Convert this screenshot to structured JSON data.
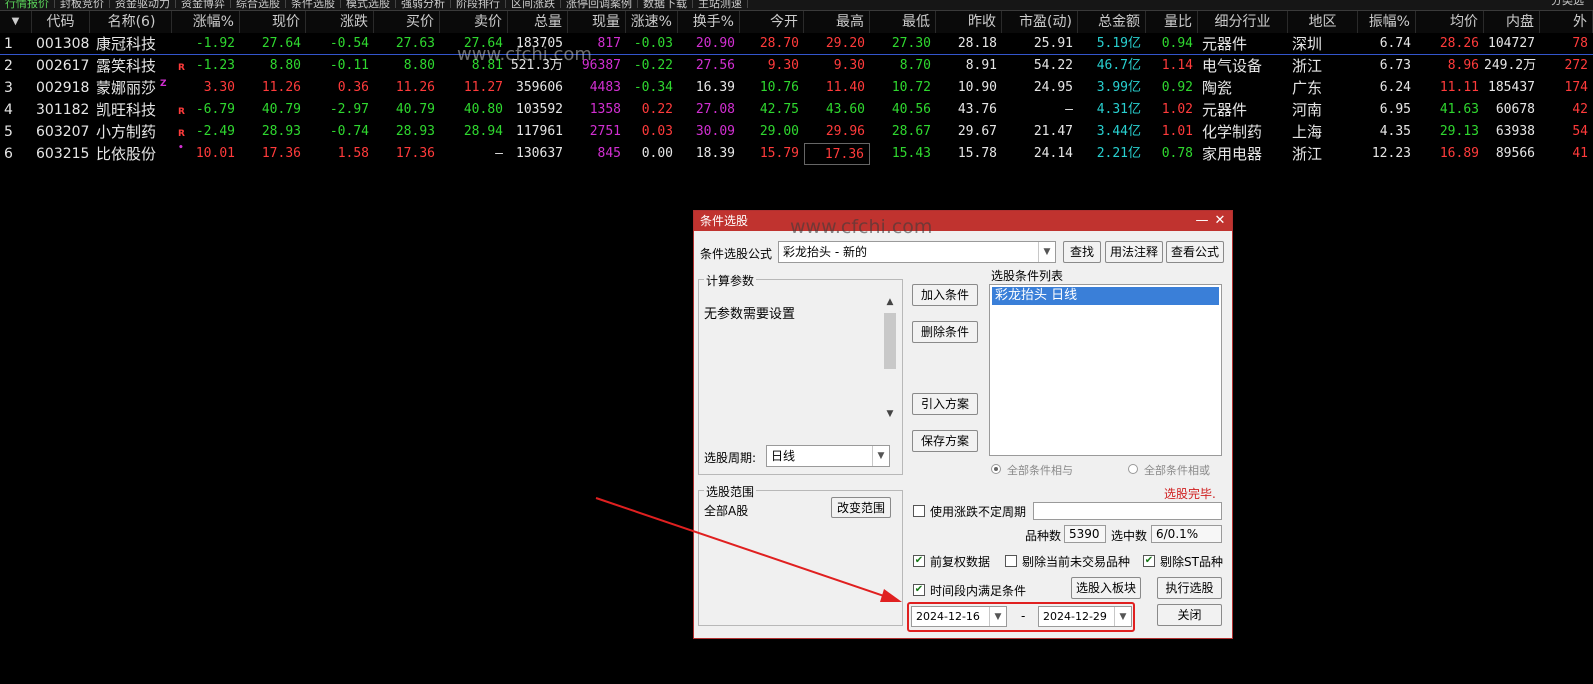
{
  "tabs": {
    "items": [
      "行情报价",
      "封板竞价",
      "资金驱动力",
      "资金博弈",
      "综合选股",
      "条件选股",
      "模式选股",
      "强弱分析",
      "阶段排行",
      "区间涨跌",
      "涨停回调案例",
      "数据下载",
      "主站测速"
    ],
    "right": "分类选"
  },
  "table": {
    "headers": [
      "代码",
      "名称(6)",
      "涨幅%",
      "现价",
      "涨跌",
      "买价",
      "卖价",
      "总量",
      "现量",
      "涨速%",
      "换手%",
      "今开",
      "最高",
      "最低",
      "昨收",
      "市盈(动)",
      "总金额",
      "量比",
      "细分行业",
      "地区",
      "振幅%",
      "均价",
      "内盘",
      "外"
    ],
    "rows": [
      {
        "idx": "1",
        "code": "001308",
        "name": "康冠科技",
        "flag": "",
        "chg_pct": "-1.92",
        "price": "27.64",
        "chg": "-0.54",
        "bid": "27.63",
        "ask": "27.64",
        "vol": "183705",
        "cur_vol": "817",
        "speed": "-0.03",
        "turnover": "20.90",
        "open": "28.70",
        "high": "29.20",
        "low": "27.30",
        "prev": "28.18",
        "pe": "25.91",
        "amount": "5.19亿",
        "vol_ratio": "0.94",
        "industry": "元器件",
        "region": "深圳",
        "amplitude": "6.74",
        "avg": "28.26",
        "inner": "104727",
        "outer": "78"
      },
      {
        "idx": "2",
        "code": "002617",
        "name": "露笑科技",
        "flag": "R",
        "chg_pct": "-1.23",
        "price": "8.80",
        "chg": "-0.11",
        "bid": "8.80",
        "ask": "8.81",
        "vol": "521.3万",
        "cur_vol": "96387",
        "speed": "-0.22",
        "turnover": "27.56",
        "open": "9.30",
        "high": "9.30",
        "low": "8.70",
        "prev": "8.91",
        "pe": "54.22",
        "amount": "46.7亿",
        "vol_ratio": "1.14",
        "industry": "电气设备",
        "region": "浙江",
        "amplitude": "6.73",
        "avg": "8.96",
        "inner": "249.2万",
        "outer": "272"
      },
      {
        "idx": "3",
        "code": "002918",
        "name": "蒙娜丽莎",
        "flag": "Z",
        "chg_pct": "3.30",
        "price": "11.26",
        "chg": "0.36",
        "bid": "11.26",
        "ask": "11.27",
        "vol": "359606",
        "cur_vol": "4483",
        "speed": "-0.34",
        "turnover": "16.39",
        "open": "10.76",
        "high": "11.40",
        "low": "10.72",
        "prev": "10.90",
        "pe": "24.95",
        "amount": "3.99亿",
        "vol_ratio": "0.92",
        "industry": "陶瓷",
        "region": "广东",
        "amplitude": "6.24",
        "avg": "11.11",
        "inner": "185437",
        "outer": "174"
      },
      {
        "idx": "4",
        "code": "301182",
        "name": "凯旺科技",
        "flag": "R",
        "chg_pct": "-6.79",
        "price": "40.79",
        "chg": "-2.97",
        "bid": "40.79",
        "ask": "40.80",
        "vol": "103592",
        "cur_vol": "1358",
        "speed": "0.22",
        "turnover": "27.08",
        "open": "42.75",
        "high": "43.60",
        "low": "40.56",
        "prev": "43.76",
        "pe": "—",
        "amount": "4.31亿",
        "vol_ratio": "1.02",
        "industry": "元器件",
        "region": "河南",
        "amplitude": "6.95",
        "avg": "41.63",
        "inner": "60678",
        "outer": "42"
      },
      {
        "idx": "5",
        "code": "603207",
        "name": "小方制药",
        "flag": "R",
        "chg_pct": "-2.49",
        "price": "28.93",
        "chg": "-0.74",
        "bid": "28.93",
        "ask": "28.94",
        "vol": "117961",
        "cur_vol": "2751",
        "speed": "0.03",
        "turnover": "30.09",
        "open": "29.00",
        "high": "29.96",
        "low": "28.67",
        "prev": "29.67",
        "pe": "21.47",
        "amount": "3.44亿",
        "vol_ratio": "1.01",
        "industry": "化学制药",
        "region": "上海",
        "amplitude": "4.35",
        "avg": "29.13",
        "inner": "63938",
        "outer": "54"
      },
      {
        "idx": "6",
        "code": "603215",
        "name": "比依股份",
        "flag": "•",
        "chg_pct": "10.01",
        "price": "17.36",
        "chg": "1.58",
        "bid": "17.36",
        "ask": "—",
        "vol": "130637",
        "cur_vol": "845",
        "speed": "0.00",
        "turnover": "18.39",
        "open": "15.79",
        "high": "17.36",
        "low": "15.43",
        "prev": "15.78",
        "pe": "24.14",
        "amount": "2.21亿",
        "vol_ratio": "0.78",
        "industry": "家用电器",
        "region": "浙江",
        "amplitude": "12.23",
        "avg": "16.89",
        "inner": "89566",
        "outer": "41"
      }
    ]
  },
  "watermark": "www.cfchi.com",
  "dialog": {
    "title": "条件选股",
    "formula_label": "条件选股公式",
    "formula_value": "彩龙抬头 - 新的",
    "btn_find": "查找",
    "btn_usage": "用法注释",
    "btn_view": "查看公式",
    "calc_group": "计算参数",
    "calc_text": "无参数需要设置",
    "period_label": "选股周期:",
    "period_value": "日线",
    "btn_add": "加入条件",
    "btn_delete": "删除条件",
    "btn_import": "引入方案",
    "btn_save": "保存方案",
    "list_label": "选股条件列表",
    "list_items": [
      "彩龙抬头  日线"
    ],
    "radio_and": "全部条件相与",
    "radio_or": "全部条件相或",
    "status": "选股完毕.",
    "range_group": "选股范围",
    "range_value": "全部A股",
    "btn_change_range": "改变范围",
    "use_uncertain_label": "使用涨跌不定周期",
    "count_label": "品种数",
    "count_value": "5390",
    "selected_label": "选中数",
    "selected_value": "6/0.1%",
    "cb_adjust": "前复权数据",
    "cb_exclude_untraded": "剔除当前未交易品种",
    "cb_exclude_st": "剔除ST品种",
    "cb_timespan": "时间段内满足条件",
    "btn_to_block": "选股入板块",
    "btn_execute": "执行选股",
    "date_from": "2024-12-16",
    "date_sep": "-",
    "date_to": "2024-12-29",
    "btn_close": "关闭"
  },
  "colors": {
    "accent_red": "#e02020",
    "up": "#ff3b3b",
    "down": "#2fd82f",
    "dialog_title": "#c0332f",
    "list_selected": "#3a7fd8"
  }
}
